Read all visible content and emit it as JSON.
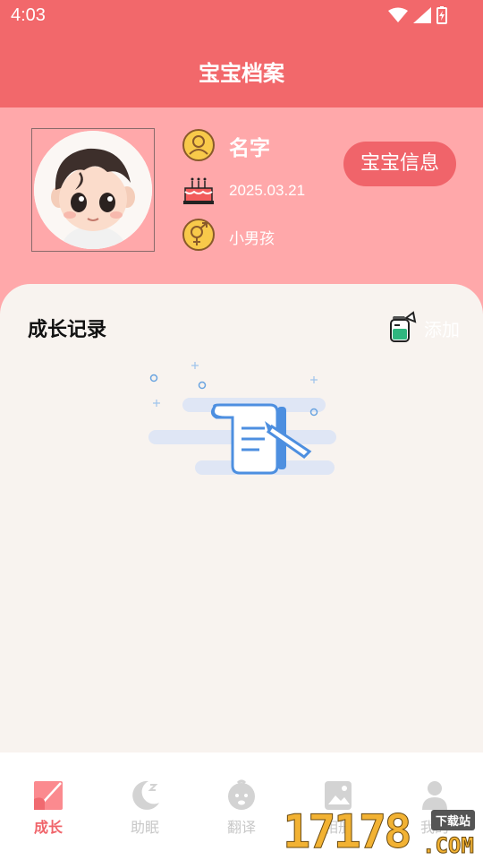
{
  "status_bar": {
    "time": "4:03",
    "icons": [
      "wifi-icon",
      "signal-icon",
      "battery-icon"
    ]
  },
  "header": {
    "title": "宝宝档案"
  },
  "profile": {
    "avatar": "cartoon-baby-avatar",
    "name": "名字",
    "birthday": "2025.03.21",
    "gender": "小男孩",
    "info_button": "宝宝信息"
  },
  "growth": {
    "title": "成长记录",
    "add_label": "添加",
    "empty_state": "empty-records-illustration"
  },
  "tabs": [
    {
      "label": "成长",
      "icon": "growth-icon",
      "active": true
    },
    {
      "label": "助眠",
      "icon": "moon-icon",
      "active": false
    },
    {
      "label": "翻译",
      "icon": "baby-face-icon",
      "active": false
    },
    {
      "label": "相册",
      "icon": "photo-icon",
      "active": false
    },
    {
      "label": "我的",
      "icon": "person-icon",
      "active": false
    }
  ],
  "watermark": {
    "digits": "17178",
    "tag": "下载站",
    "suffix": ".COM"
  },
  "colors": {
    "primary": "#f2686b",
    "profile_bg": "#ffa8aa",
    "card_bg": "#f8f3ef",
    "tab_inactive": "#c8c8c8"
  }
}
